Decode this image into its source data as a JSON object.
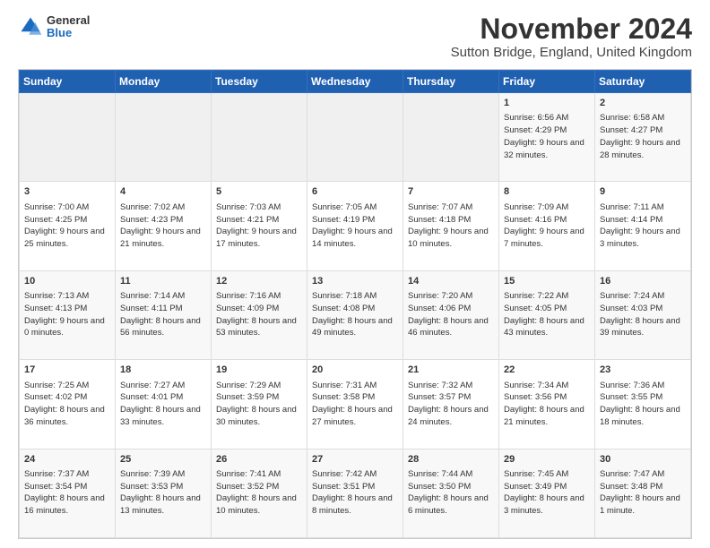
{
  "header": {
    "logo": {
      "general": "General",
      "blue": "Blue"
    },
    "title": "November 2024",
    "location": "Sutton Bridge, England, United Kingdom"
  },
  "weekdays": [
    "Sunday",
    "Monday",
    "Tuesday",
    "Wednesday",
    "Thursday",
    "Friday",
    "Saturday"
  ],
  "weeks": [
    [
      {
        "day": "",
        "info": ""
      },
      {
        "day": "",
        "info": ""
      },
      {
        "day": "",
        "info": ""
      },
      {
        "day": "",
        "info": ""
      },
      {
        "day": "",
        "info": ""
      },
      {
        "day": "1",
        "info": "Sunrise: 6:56 AM\nSunset: 4:29 PM\nDaylight: 9 hours and 32 minutes."
      },
      {
        "day": "2",
        "info": "Sunrise: 6:58 AM\nSunset: 4:27 PM\nDaylight: 9 hours and 28 minutes."
      }
    ],
    [
      {
        "day": "3",
        "info": "Sunrise: 7:00 AM\nSunset: 4:25 PM\nDaylight: 9 hours and 25 minutes."
      },
      {
        "day": "4",
        "info": "Sunrise: 7:02 AM\nSunset: 4:23 PM\nDaylight: 9 hours and 21 minutes."
      },
      {
        "day": "5",
        "info": "Sunrise: 7:03 AM\nSunset: 4:21 PM\nDaylight: 9 hours and 17 minutes."
      },
      {
        "day": "6",
        "info": "Sunrise: 7:05 AM\nSunset: 4:19 PM\nDaylight: 9 hours and 14 minutes."
      },
      {
        "day": "7",
        "info": "Sunrise: 7:07 AM\nSunset: 4:18 PM\nDaylight: 9 hours and 10 minutes."
      },
      {
        "day": "8",
        "info": "Sunrise: 7:09 AM\nSunset: 4:16 PM\nDaylight: 9 hours and 7 minutes."
      },
      {
        "day": "9",
        "info": "Sunrise: 7:11 AM\nSunset: 4:14 PM\nDaylight: 9 hours and 3 minutes."
      }
    ],
    [
      {
        "day": "10",
        "info": "Sunrise: 7:13 AM\nSunset: 4:13 PM\nDaylight: 9 hours and 0 minutes."
      },
      {
        "day": "11",
        "info": "Sunrise: 7:14 AM\nSunset: 4:11 PM\nDaylight: 8 hours and 56 minutes."
      },
      {
        "day": "12",
        "info": "Sunrise: 7:16 AM\nSunset: 4:09 PM\nDaylight: 8 hours and 53 minutes."
      },
      {
        "day": "13",
        "info": "Sunrise: 7:18 AM\nSunset: 4:08 PM\nDaylight: 8 hours and 49 minutes."
      },
      {
        "day": "14",
        "info": "Sunrise: 7:20 AM\nSunset: 4:06 PM\nDaylight: 8 hours and 46 minutes."
      },
      {
        "day": "15",
        "info": "Sunrise: 7:22 AM\nSunset: 4:05 PM\nDaylight: 8 hours and 43 minutes."
      },
      {
        "day": "16",
        "info": "Sunrise: 7:24 AM\nSunset: 4:03 PM\nDaylight: 8 hours and 39 minutes."
      }
    ],
    [
      {
        "day": "17",
        "info": "Sunrise: 7:25 AM\nSunset: 4:02 PM\nDaylight: 8 hours and 36 minutes."
      },
      {
        "day": "18",
        "info": "Sunrise: 7:27 AM\nSunset: 4:01 PM\nDaylight: 8 hours and 33 minutes."
      },
      {
        "day": "19",
        "info": "Sunrise: 7:29 AM\nSunset: 3:59 PM\nDaylight: 8 hours and 30 minutes."
      },
      {
        "day": "20",
        "info": "Sunrise: 7:31 AM\nSunset: 3:58 PM\nDaylight: 8 hours and 27 minutes."
      },
      {
        "day": "21",
        "info": "Sunrise: 7:32 AM\nSunset: 3:57 PM\nDaylight: 8 hours and 24 minutes."
      },
      {
        "day": "22",
        "info": "Sunrise: 7:34 AM\nSunset: 3:56 PM\nDaylight: 8 hours and 21 minutes."
      },
      {
        "day": "23",
        "info": "Sunrise: 7:36 AM\nSunset: 3:55 PM\nDaylight: 8 hours and 18 minutes."
      }
    ],
    [
      {
        "day": "24",
        "info": "Sunrise: 7:37 AM\nSunset: 3:54 PM\nDaylight: 8 hours and 16 minutes."
      },
      {
        "day": "25",
        "info": "Sunrise: 7:39 AM\nSunset: 3:53 PM\nDaylight: 8 hours and 13 minutes."
      },
      {
        "day": "26",
        "info": "Sunrise: 7:41 AM\nSunset: 3:52 PM\nDaylight: 8 hours and 10 minutes."
      },
      {
        "day": "27",
        "info": "Sunrise: 7:42 AM\nSunset: 3:51 PM\nDaylight: 8 hours and 8 minutes."
      },
      {
        "day": "28",
        "info": "Sunrise: 7:44 AM\nSunset: 3:50 PM\nDaylight: 8 hours and 6 minutes."
      },
      {
        "day": "29",
        "info": "Sunrise: 7:45 AM\nSunset: 3:49 PM\nDaylight: 8 hours and 3 minutes."
      },
      {
        "day": "30",
        "info": "Sunrise: 7:47 AM\nSunset: 3:48 PM\nDaylight: 8 hours and 1 minute."
      }
    ]
  ]
}
